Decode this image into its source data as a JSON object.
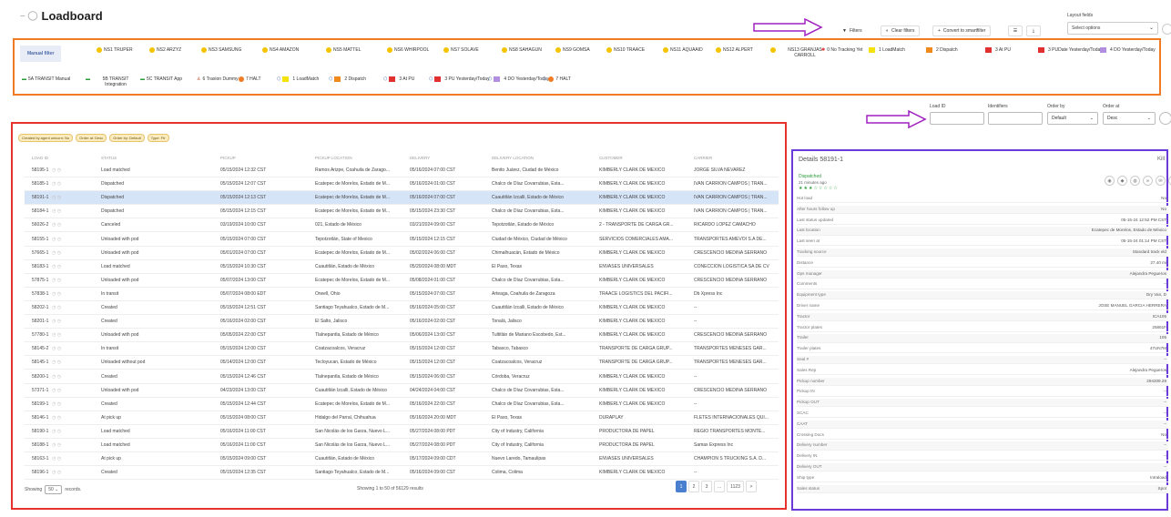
{
  "header": {
    "title": "Loadboard"
  },
  "toolbar": {
    "filters": "Filters",
    "clear_filters": "Clear filters",
    "convert": "Convert to smartfilter",
    "layout_label": "Layout fields",
    "layout_placeholder": "Select options"
  },
  "chips_row1": [
    {
      "label": "Manual filter",
      "kind": "first"
    },
    {
      "label": "NS1 TRUPER",
      "kind": "face"
    },
    {
      "label": "NS2 ARZYZ",
      "kind": "face"
    },
    {
      "label": "NS3 SAMSUNG",
      "kind": "face"
    },
    {
      "label": "NS4 AMAZON",
      "kind": "face"
    },
    {
      "label": "NS5 MATTEL",
      "kind": "face"
    },
    {
      "label": "NS6 WHIRPOOL",
      "kind": "face"
    },
    {
      "label": "NS7 SOLAVE",
      "kind": "face"
    },
    {
      "label": "NS8 SAHAGUN",
      "kind": "face"
    },
    {
      "label": "NS9 GOMSA",
      "kind": "face"
    },
    {
      "label": "NS10 TRAACE",
      "kind": "face"
    },
    {
      "label": "NS11 AQUAAID",
      "kind": "face"
    },
    {
      "label": "NS12 ALPERT",
      "kind": "face"
    },
    {
      "label": "NS13 GRANJAS CARROLL",
      "kind": "face"
    },
    {
      "label": "0 No Tracking Yet",
      "kind": "pin"
    },
    {
      "label": "1 LoadMatch",
      "kind": "sq",
      "color": "#f5e20a"
    },
    {
      "label": "2 Dispatch",
      "kind": "sq",
      "color": "#f08a1c"
    },
    {
      "label": "3 At PU",
      "kind": "sq",
      "color": "#e03030"
    },
    {
      "label": "3 PUDate Yesterday/Today",
      "kind": "sq",
      "color": "#e03030"
    },
    {
      "label": "4 DO Yesterday/Today",
      "kind": "sq",
      "color": "#b28ee0"
    }
  ],
  "chips_row2": [
    {
      "label": "5A TRANSIT Manual",
      "kind": "truck"
    },
    {
      "label": "5B TRANSIT Integration",
      "kind": "truck"
    },
    {
      "label": "5C TRANSIT App",
      "kind": "truck"
    },
    {
      "label": "6 Traxion Dummy",
      "kind": "person"
    },
    {
      "label": "7 HALT",
      "kind": "dot",
      "color": "#f07b24"
    },
    {
      "label": "1 LoadMatch",
      "kind": "tagsq",
      "color": "#f5e20a"
    },
    {
      "label": "2 Dispatch",
      "kind": "tagsq",
      "color": "#f08a1c"
    },
    {
      "label": "3 At PU",
      "kind": "tagsq",
      "color": "#e03030"
    },
    {
      "label": "3 PU Yesterday/Today",
      "kind": "tagsq",
      "color": "#e03030"
    },
    {
      "label": "4 DO Yesterday/Today",
      "kind": "tagsq",
      "color": "#b28ee0"
    },
    {
      "label": "7 HALT",
      "kind": "tagdot",
      "color": "#f07b24"
    }
  ],
  "search": {
    "load_id_label": "Load ID",
    "identifiers_label": "Identifiers",
    "order_by_label": "Order by",
    "order_by_value": "Default",
    "order_at_label": "Order at",
    "order_at_value": "Desc"
  },
  "tags": [
    "Created by agent unicorn: No",
    "Order at: Desc",
    "Order by: Default",
    "Type: Ftr"
  ],
  "table": {
    "headers": [
      "LOAD ID",
      "STATUS",
      "PICKUP",
      "PICKUP LOCATION",
      "DELIVERY",
      "DELIVERY LOCATION",
      "CUSTOMER",
      "CARRIER"
    ],
    "rows": [
      [
        "58195-1",
        "Load matched",
        "05/15/2024 12:32 CST",
        "Ramos Arizpe, Coahuila de Zarago...",
        "05/16/2024 07:00 CST",
        "Benito Juárez, Ciudad de México",
        "KIMBERLY CLARK DE MEXICO",
        "JORGE SILVA NEVAREZ"
      ],
      [
        "58185-1",
        "Dispatched",
        "05/15/2024 12:07 CST",
        "Ecatepec de Morelos, Estado de M...",
        "05/16/2024 01:00 CST",
        "Chalco de Díaz Covarrubias, Esta...",
        "KIMBERLY CLARK DE MEXICO",
        "IVAN CARRION CAMPOS | TRAN..."
      ],
      [
        "58191-1",
        "Dispatched",
        "05/15/2024 12:13 CST",
        "Ecatepec de Morelos, Estado de M...",
        "05/16/2024 07:00 CST",
        "Cuautitlán Izcalli, Estado de México",
        "KIMBERLY CLARK DE MEXICO",
        "IVAN CARRION CAMPOS | TRAN..."
      ],
      [
        "58184-1",
        "Dispatched",
        "05/15/2024 12:15 CST",
        "Ecatepec de Morelos, Estado de M...",
        "05/15/2024 23:30 CST",
        "Chalco de Díaz Covarrubias, Esta...",
        "KIMBERLY CLARK DE MEXICO",
        "IVAN CARRION CAMPOS | TRAN..."
      ],
      [
        "56026-2",
        "Canceled",
        "03/19/2024 10:00 CST",
        "021, Estado de México",
        "03/21/2024 09:00 CST",
        "Tepotzotlán, Estado de México",
        "2 - TRANSPORTE DE CARGA GR...",
        "RICARDO LOPEZ CAMACHO"
      ],
      [
        "58155-1",
        "Unloaded with pod",
        "05/15/2024 07:00 CST",
        "Tepotzotlán, State of Mexico",
        "05/15/2024 12:15 CST",
        "Ciudad de México, Ciudad de México",
        "SERVICIOS COMERCIALES AMA...",
        "TRANSPORTES AMEVOI S.A DE..."
      ],
      [
        "57665-1",
        "Unloaded with pod",
        "05/01/2024 07:00 CST",
        "Ecatepec de Morelos, Estado de M...",
        "05/02/2024 06:00 CST",
        "Chimalhuacán, Estado de México",
        "KIMBERLY CLARK DE MEXICO",
        "CRESCENCIO MEDINA SERRANO"
      ],
      [
        "58183-1",
        "Load matched",
        "05/15/2024 10:30 CST",
        "Cuautitlán, Estado de México",
        "05/20/2024 08:00 MDT",
        "El Paso, Texas",
        "ENVASES UNIVERSALES",
        "CONECCION LOGISTICA SA DE CV"
      ],
      [
        "57875-1",
        "Unloaded with pod",
        "05/07/2024 13:00 CST",
        "Ecatepec de Morelos, Estado de M...",
        "05/08/2024 01:00 CST",
        "Chalco de Díaz Covarrubias, Esta...",
        "KIMBERLY CLARK DE MEXICO",
        "CRESCENCIO MEDINA SERRANO"
      ],
      [
        "57838-1",
        "In transit",
        "05/07/2024 08:00 EDT",
        "Orwell, Ohio",
        "05/15/2024 07:00 CST",
        "Arteaga, Coahuila de Zaragoza",
        "TRAACE LOGISTICS DEL PACIFI...",
        "Db Xpress Inc"
      ],
      [
        "58202-1",
        "Created",
        "05/15/2024 12:51 CST",
        "Santiago Teyahualco, Estado de M...",
        "05/16/2024 05:00 CST",
        "Cuautitlán Izcalli, Estado de México",
        "KIMBERLY CLARK DE MEXICO",
        "--"
      ],
      [
        "58201-1",
        "Created",
        "05/16/2024 02:00 CST",
        "El Salto, Jalisco",
        "05/16/2024 02:00 CST",
        "Tonalá, Jalisco",
        "KIMBERLY CLARK DE MEXICO",
        "--"
      ],
      [
        "57780-1",
        "Unloaded with pod",
        "05/05/2024 22:00 CST",
        "Tlalnepantla, Estado de México",
        "05/06/2024 13:00 CST",
        "Tultitlán de Mariano Escobedo, Est...",
        "KIMBERLY CLARK DE MEXICO",
        "CRESCENCIO MEDINA SERRANO"
      ],
      [
        "58145-2",
        "In transit",
        "05/15/2024 12:00 CST",
        "Coatzacoalcos, Veracruz",
        "05/15/2024 12:00 CST",
        "Tabasco, Tabasco",
        "TRANSPORTE DE CARGA GRUP...",
        "TRANSPORTES MENESES GAR..."
      ],
      [
        "58145-1",
        "Unloaded without pod",
        "05/14/2024 12:00 CST",
        "Tecloyucan, Estado de México",
        "05/15/2024 12:00 CST",
        "Coatzacoalcos, Veracruz",
        "TRANSPORTE DE CARGA GRUP...",
        "TRANSPORTES MENESES GAR..."
      ],
      [
        "58200-1",
        "Created",
        "05/15/2024 12:46 CST",
        "Tlalnepantla, Estado de México",
        "05/15/2024 06:00 CST",
        "Córdoba, Veracruz",
        "KIMBERLY CLARK DE MEXICO",
        "--"
      ],
      [
        "57371-1",
        "Unloaded with pod",
        "04/23/2024 13:00 CST",
        "Cuautitlán Izcalli, Estado de México",
        "04/24/2024 04:00 CST",
        "Chalco de Díaz Covarrubias, Esta...",
        "KIMBERLY CLARK DE MEXICO",
        "CRESCENCIO MEDINA SERRANO"
      ],
      [
        "58199-1",
        "Created",
        "05/15/2024 12:44 CST",
        "Ecatepec de Morelos, Estado de M...",
        "05/16/2024 22:00 CST",
        "Chalco de Díaz Covarrubias, Esta...",
        "KIMBERLY CLARK DE MEXICO",
        "--"
      ],
      [
        "58146-1",
        "At pick up",
        "05/15/2024 08:00 CST",
        "Hidalgo del Parral, Chihuahua",
        "05/16/2024 20:00 MDT",
        "El Paso, Texas",
        "DURAPLAY",
        "FLETES INTERNACIONALES QUI..."
      ],
      [
        "58190-1",
        "Load matched",
        "05/16/2024 11:00 CST",
        "San Nicolás de los Garza, Nuevo L...",
        "05/27/2024 08:00 PDT",
        "City of Industry, California",
        "PRODUCTORA DE PAPEL",
        "REGIO TRANSPORTES MONTE..."
      ],
      [
        "58188-1",
        "Load matched",
        "05/16/2024 11:00 CST",
        "San Nicolás de los Garza, Nuevo L...",
        "05/27/2024 08:00 PDT",
        "City of Industry, California",
        "PRODUCTORA DE PAPEL",
        "Samax Express Inc"
      ],
      [
        "58163-1",
        "At pick up",
        "05/15/2024 09:00 CST",
        "Cuautitlán, Estado de México",
        "05/17/2024 09:00 CDT",
        "Nuevo Laredo, Tamaulipas",
        "ENVASES UNIVERSALES",
        "CHAMPION S TRUCKING S.A. D..."
      ],
      [
        "58196-1",
        "Created",
        "05/15/2024 12:35 CST",
        "Santiago Teyahualco, Estado de M...",
        "05/16/2024 09:00 CST",
        "Colima, Colima",
        "KIMBERLY CLARK DE MEXICO",
        "--"
      ]
    ],
    "selected_index": 2
  },
  "footer": {
    "showing_label": "Showing",
    "page_size": "50",
    "records_label": "records.",
    "results": "Showing 1 to 50 of 56129 results",
    "pages": [
      "1",
      "2",
      "3",
      "...",
      "1123",
      ">"
    ]
  },
  "details": {
    "title": "Details 58191-1",
    "close": "Kill",
    "status": "Dispatched",
    "ago": "21 minutes ago",
    "stars": "★★★☆☆☆☆☆",
    "fields": [
      [
        "Hot load",
        "No"
      ],
      [
        "After hours follow up",
        "No"
      ],
      [
        "Last status updated",
        "05-15-24 12:52 PM CST"
      ],
      [
        "Last location",
        "Ecatepec de Morelos, Estado de México"
      ],
      [
        "Last seen at",
        "05-15-24 01:14 PM CST"
      ],
      [
        "Tracking source",
        "Standard track eld"
      ],
      [
        "Distance",
        "27.40 mi"
      ],
      [
        "Ops manager",
        "Alejandra Pegueros"
      ],
      [
        "Comments",
        "--"
      ],
      [
        "Equipment type",
        "Dry Van, D"
      ],
      [
        "Driver name",
        "JOSE MANUEL GARCIA HERRERA"
      ],
      [
        "Tractor",
        "ICA105"
      ],
      [
        "Tractor plates",
        "25861F"
      ],
      [
        "Trailer",
        "105"
      ],
      [
        "Trailer plates",
        "47UN7M"
      ],
      [
        "Seal #",
        "--"
      ],
      [
        "Sales Rep",
        "Alejandra Pegueros"
      ],
      [
        "Pickup number",
        "294209.28"
      ],
      [
        "Pickup IN",
        "--"
      ],
      [
        "Pickup OUT",
        "--"
      ],
      [
        "SCAC",
        "--"
      ],
      [
        "CAAT",
        "--"
      ],
      [
        "Crossing Docs",
        "No"
      ],
      [
        "Delivery number",
        "--"
      ],
      [
        "Delivery IN",
        "--"
      ],
      [
        "Delivery OUT",
        "--"
      ],
      [
        "Ship type",
        "Intraload"
      ],
      [
        "Sales status",
        "Spot"
      ]
    ]
  },
  "colors": {
    "filter_border": "#f07b24",
    "grid_border": "#e5322d",
    "details_border": "#6a3bd8",
    "arrow": "#a020c0",
    "accent": "#4a7fd0"
  }
}
